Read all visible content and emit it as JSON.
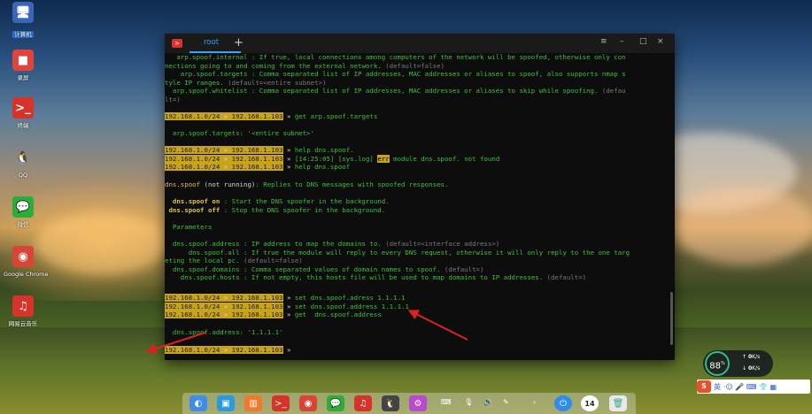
{
  "desktop": {
    "icons": [
      {
        "label": "计算机",
        "glyph": "🖥",
        "color": "#3a66b8",
        "selected": true
      },
      {
        "label": "录屏",
        "glyph": "■",
        "color": "#e0443c"
      },
      {
        "label": "终端",
        "glyph": ">_",
        "color": "#d7332b"
      },
      {
        "label": "QQ",
        "glyph": "🐧",
        "color": "transparent"
      },
      {
        "label": "微信",
        "glyph": "💬",
        "color": "#2aae3a"
      },
      {
        "label": "Google Chrome",
        "glyph": "◉",
        "color": "#d84536"
      },
      {
        "label": "网易云音乐",
        "glyph": "♫",
        "color": "#d7332b"
      }
    ]
  },
  "terminal": {
    "tab_title": "root",
    "add_tab": "+",
    "menu_glyph": "≡",
    "min_glyph": "–",
    "max_glyph": "□",
    "close_glyph": "×",
    "lines": {
      "l1": "   arp.spoof.internal : If true, local connections among computers of the network will be spoofed, otherwise only con",
      "l2": "nections going to and coming from the external network. ",
      "l2d": "(default=false)",
      "l3": "    arp.spoof.targets : Comma separated list of IP addresses, MAC addresses or aliases to spoof, also supports nmap s",
      "l4": "tyle IP ranges. ",
      "l4d": "(default=<entire subnet>)",
      "l5": "  arp.spoof.whitelist : Comma separated list of IP addresses, MAC addresses or aliases to skip while spoofing. ",
      "l5d": "(defau",
      "l6d": "lt=)",
      "p_net": "192.168.1.0/24",
      "p_gt": " > ",
      "p_host": "192.168.1.103",
      "p_arrow": " » ",
      "c1": "get arp.spoof.targets",
      "r1": "  arp.spoof.targets: '<entire subnet>'",
      "c2": "help dns.spoof.",
      "c3a": "[14:25:05] [sys.log] ",
      "c3b": "err",
      "c3c": " module dns.spoof. not found",
      "c4": "help dns.spoof",
      "h1a": "dns.spoof",
      "h1b": " (not running)",
      "h1c": ": Replies to DNS messages with spoofed responses.",
      "h2a": "  dns.spoof on",
      "h2b": " : Start the DNS spoofer in the background.",
      "h3a": " dns.spoof off",
      "h3b": " : Stop the DNS spoofer in the background.",
      "h4": "  Parameters",
      "h5": "  dns.spoof.address : IP address to map the domains to. ",
      "h5d": "(default=<interface address>)",
      "h6": "      dns.spoof.all : If true the module will reply to every DNS request, otherwise it will only reply to the one targ",
      "h7": "eting the local pc. ",
      "h7d": "(default=false)",
      "h8": "  dns.spoof.domains : Comma separated values of domain names to spoof. ",
      "h8d": "(default=)",
      "h9": "    dns.spoof.hosts : If not empty, this hosts file will be used to map domains to IP addresses. ",
      "h9d": "(default=)",
      "c5": "set dns.spoof.adress 1.1.1.1",
      "c6": "set dns.spoof.address 1.1.1.1",
      "c7": "get  dns.spoof.address",
      "r2": "  dns.spoof.address: '1.1.1.1'"
    }
  },
  "widget": {
    "percent": "88",
    "percent_unit": "%",
    "up": "0",
    "up_unit": "K/s",
    "down": "0",
    "down_unit": "K/s"
  },
  "ime": {
    "logo": "S",
    "lang": "英",
    "tools": "·☺ 🎤 ⌨ 👕 ▦"
  },
  "dock": {
    "items": [
      {
        "glyph": "◐",
        "color": "#3e8ee8"
      },
      {
        "glyph": "▣",
        "color": "#2a9ae0"
      },
      {
        "glyph": "▥",
        "color": "#f07a2a"
      },
      {
        "glyph": ">_",
        "color": "#d7332b"
      },
      {
        "glyph": "◉",
        "color": "#d84536"
      },
      {
        "glyph": "💬",
        "color": "#2aae3a"
      },
      {
        "glyph": "♫",
        "color": "#d7332b"
      },
      {
        "glyph": "🐧",
        "color": "#444"
      },
      {
        "glyph": "⚙",
        "color": "#b94ad0"
      }
    ],
    "tray": [
      "⌨",
      "🎙",
      "🔊",
      "✎",
      "‹"
    ],
    "power": "⏻",
    "clock": "14",
    "trash": "🗑"
  }
}
